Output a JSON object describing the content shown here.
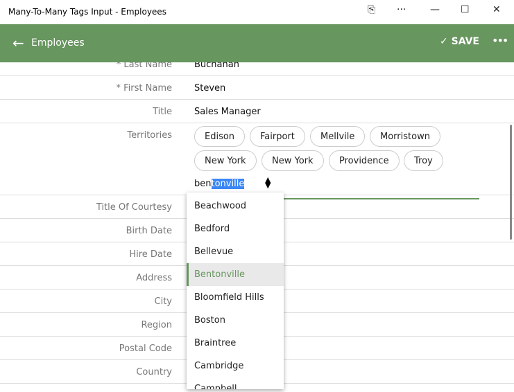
{
  "window": {
    "title": "Many-To-Many Tags Input - Employees"
  },
  "header": {
    "back_label": "Employees",
    "save_label": "SAVE"
  },
  "fields": {
    "last_name": {
      "label": "* Last Name",
      "value": "Buchanan"
    },
    "first_name": {
      "label": "* First Name",
      "value": "Steven"
    },
    "title": {
      "label": "Title",
      "value": "Sales Manager"
    },
    "territories": {
      "label": "Territories",
      "tags": [
        "Edison",
        "Fairport",
        "Mellvile",
        "Morristown",
        "New York",
        "New York",
        "Providence",
        "Troy"
      ],
      "input_typed": "ben",
      "input_autocomplete": "tonville"
    },
    "title_of_courtesy": {
      "label": "Title Of Courtesy"
    },
    "birth_date": {
      "label": "Birth Date"
    },
    "hire_date": {
      "label": "Hire Date"
    },
    "address": {
      "label": "Address"
    },
    "city": {
      "label": "City"
    },
    "region": {
      "label": "Region"
    },
    "postal_code": {
      "label": "Postal Code"
    },
    "country": {
      "label": "Country"
    }
  },
  "dropdown": {
    "options": [
      "Beachwood",
      "Bedford",
      "Bellevue",
      "Bentonville",
      "Bloomfield Hills",
      "Boston",
      "Braintree",
      "Cambridge",
      "Campbell"
    ],
    "highlighted": "Bentonville"
  }
}
